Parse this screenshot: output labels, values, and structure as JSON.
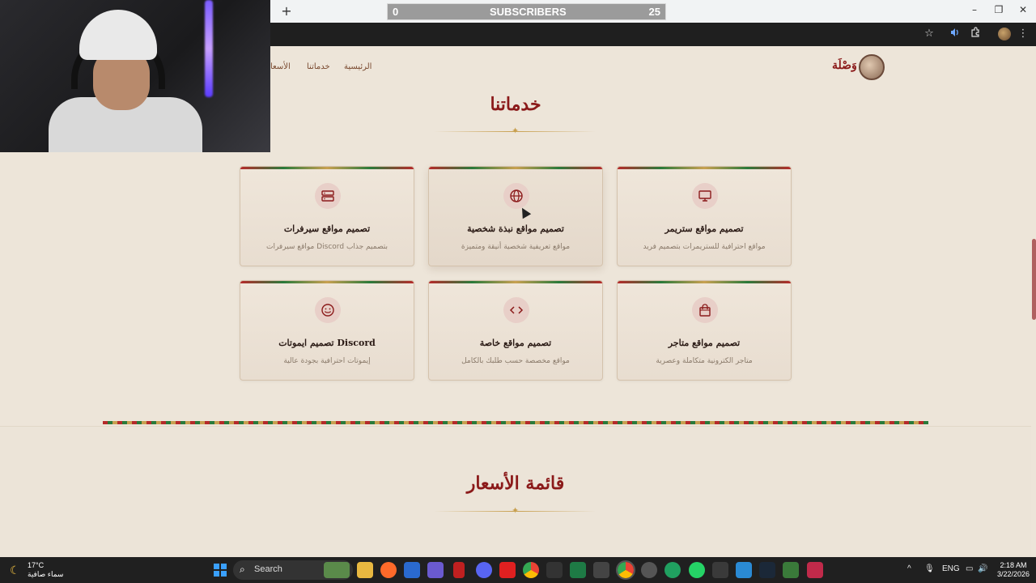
{
  "overlay": {
    "sub_start": "0",
    "sub_label": "SUBSCRIBERS",
    "sub_goal": "25"
  },
  "browser": {
    "new_tab_symbol": "+",
    "minimize_symbol": "–",
    "restore_symbol": "❐",
    "close_symbol": "✕"
  },
  "site": {
    "logo_text": "وَصْلَة",
    "nav": {
      "home": "الرئيسية",
      "services": "خدماتنا",
      "prices": "الأسعا"
    },
    "services_title": "خدماتنا",
    "services_diamond": "✦",
    "prices_title": "قائمة الأسعار",
    "prices_diamond": "✦",
    "cards": [
      {
        "title": "تصميم مواقع سيرفرات",
        "desc": "مواقع سيرفرات Discord بتصميم جذاب",
        "icon": "server-icon"
      },
      {
        "title": "تصميم مواقع نبذة شخصية",
        "desc": "مواقع تعريفية شخصية أنيقة ومتميزة",
        "icon": "globe-icon"
      },
      {
        "title": "تصميم مواقع ستريمر",
        "desc": "مواقع احترافية للستريمرات بتصميم فريد",
        "icon": "monitor-icon"
      },
      {
        "title": "تصميم ايموتات Discord",
        "desc": "إيموتات احترافية بجودة عالية",
        "icon": "smiley-icon"
      },
      {
        "title": "تصميم مواقع خاصة",
        "desc": "مواقع مخصصة حسب طلبك بالكامل",
        "icon": "code-icon"
      },
      {
        "title": "تصميم مواقع متاجر",
        "desc": "متاجر الكترونية متكاملة وعصرية",
        "icon": "shopping-bag-icon"
      }
    ]
  },
  "taskbar": {
    "weather_temp": "17°C",
    "weather_desc": "سماء صافية",
    "search_label": "Search",
    "lang": "ENG",
    "time": "2:18 AM",
    "date": "3/22/2026"
  },
  "colors": {
    "accent": "#8b1a1a",
    "gold": "#c8a050",
    "green": "#2a7a3a",
    "background": "#ede5d9"
  }
}
